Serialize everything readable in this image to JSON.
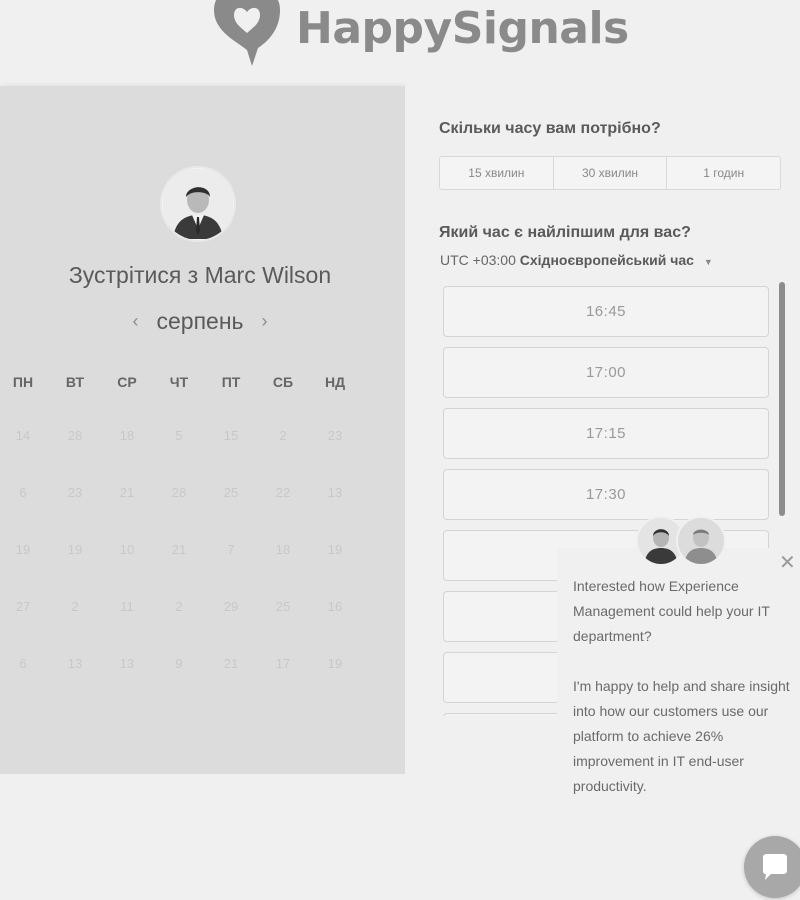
{
  "header": {
    "brand": "HappySignals"
  },
  "calendar": {
    "title": "Зустрітися з Marc Wilson",
    "month": "серпень",
    "prev_icon": "‹",
    "next_icon": "›",
    "weekdays": [
      "ПН",
      "ВТ",
      "СР",
      "ЧТ",
      "ПТ",
      "СБ",
      "НД"
    ],
    "weeks": [
      [
        "14",
        "28",
        "18",
        "5",
        "15",
        "2",
        "23"
      ],
      [
        "6",
        "23",
        "21",
        "28",
        "25",
        "22",
        "13"
      ],
      [
        "19",
        "19",
        "10",
        "21",
        "7",
        "18",
        "19"
      ],
      [
        "27",
        "2",
        "11",
        "2",
        "29",
        "25",
        "16"
      ],
      [
        "6",
        "13",
        "13",
        "9",
        "21",
        "17",
        "19"
      ]
    ]
  },
  "scheduler": {
    "duration_question": "Скільки часу вам потрібно?",
    "durations": [
      "15 хвилин",
      "30 хвилин",
      "1 годин"
    ],
    "time_question": "Який час є найліпшим для вас?",
    "timezone_offset": "UTC +03:00",
    "timezone_name": "Східноєвропейський час",
    "slots": [
      "16:45",
      "17:00",
      "17:15",
      "17:30",
      "",
      "",
      "",
      ""
    ]
  },
  "chat": {
    "message_1": "Interested how Experience Management could help your IT department?",
    "message_2": "I'm happy to help and share insight into how our customers use our platform to achieve 26% improvement in IT end-user productivity."
  },
  "colors": {
    "accent": "#8a8a8a",
    "panel": "#dcdcdc",
    "background": "#f0f0f0"
  },
  "icons": {
    "logo": "heart-speech-bubble-icon",
    "close": "close-icon",
    "launcher": "chat-bubble-icon",
    "caret": "caret-down-icon"
  }
}
